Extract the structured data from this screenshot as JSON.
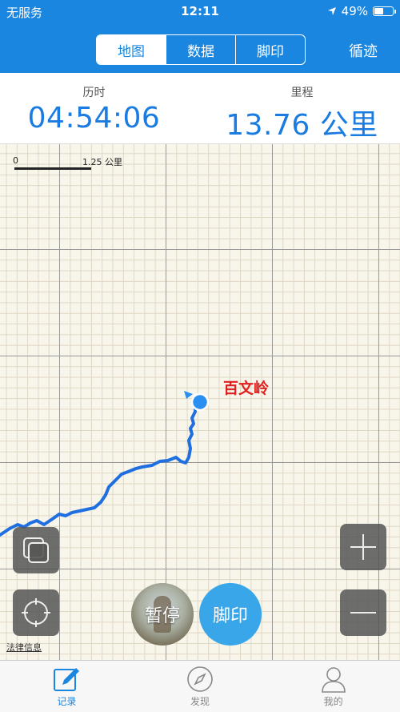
{
  "status_bar": {
    "carrier": "无服务",
    "time": "12:11",
    "battery": "49%",
    "battery_level": 0.49
  },
  "nav": {
    "tabs": [
      {
        "label": "地图",
        "active": true
      },
      {
        "label": "数据",
        "active": false
      },
      {
        "label": "脚印",
        "active": false
      }
    ],
    "right_button": "循迹"
  },
  "stats": {
    "duration_label": "历时",
    "duration_value": "04:54:06",
    "distance_label": "里程",
    "distance_value": "13.76 公里"
  },
  "map": {
    "scale_start": "0",
    "scale_end": "1.25 公里",
    "peak_label": "百文岭",
    "legal_link": "法律信息",
    "route_color": "#1f6fe0",
    "background_color": "#f8f5ea"
  },
  "actions": {
    "pause_label": "暂停",
    "footprint_label": "脚印"
  },
  "tabbar": {
    "items": [
      {
        "label": "记录",
        "icon": "pencil-icon",
        "active": true
      },
      {
        "label": "发现",
        "icon": "compass-icon",
        "active": false
      },
      {
        "label": "我的",
        "icon": "person-icon",
        "active": false
      }
    ]
  },
  "colors": {
    "accent": "#1a86e0",
    "value_text": "#1a7be0",
    "peak_text": "#e02020",
    "footprint_button": "#39a6ea"
  }
}
